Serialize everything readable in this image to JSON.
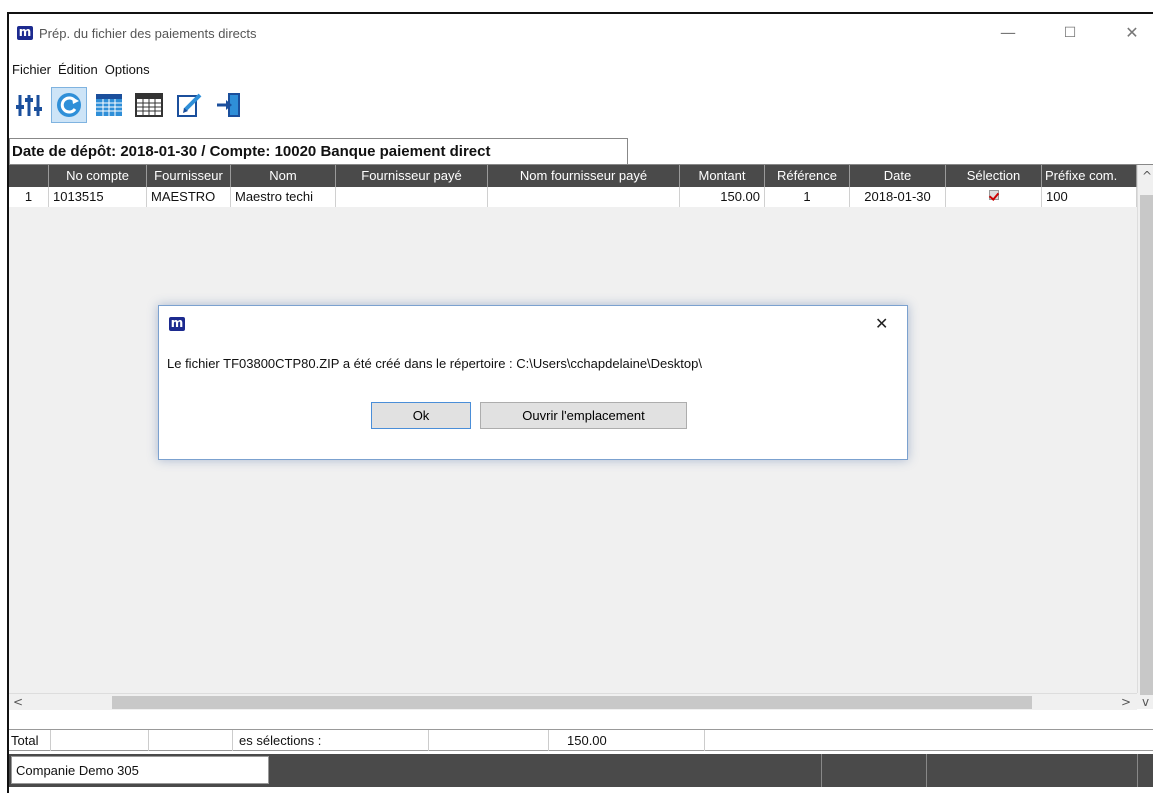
{
  "window": {
    "title": "Prép. du fichier des paiements directs",
    "logo_letter": "m",
    "controls": {
      "minimize": "—",
      "maximize": "☐",
      "close": "✕"
    }
  },
  "menu": [
    {
      "label": "Fichier"
    },
    {
      "label": "Édition"
    },
    {
      "label": "Options"
    }
  ],
  "toolbar": {
    "buttons": [
      {
        "icon": "sliders-icon"
      },
      {
        "icon": "refresh-icon",
        "active": true
      },
      {
        "icon": "grid-blue-icon"
      },
      {
        "icon": "grid-icon"
      },
      {
        "icon": "edit-icon"
      },
      {
        "icon": "exit-icon"
      }
    ]
  },
  "tab": {
    "label": "Date de dépôt: 2018-01-30 / Compte: 10020 Banque paiement direct"
  },
  "table": {
    "columns": [
      "",
      "No compte",
      "Fournisseur",
      "Nom",
      "Fournisseur payé",
      "Nom fournisseur payé",
      "Montant",
      "Référence",
      "Date",
      "Sélection",
      "Préfixe com."
    ],
    "rows": [
      [
        "1",
        "1013515",
        "MAESTRO",
        "Maestro techi",
        "",
        "",
        "150.00",
        "1",
        "2018-01-30",
        "checked",
        "100"
      ]
    ]
  },
  "scroll": {
    "up": "^",
    "down": "v",
    "left": "<",
    "right": ">"
  },
  "totals": {
    "label": "Total",
    "selection_label": "es sélections :",
    "amount": "150.00"
  },
  "status": {
    "company": "Companie Demo 305"
  },
  "dialog": {
    "logo_letter": "m",
    "close": "✕",
    "message": "Le fichier TF03800CTP80.ZIP a été créé dans le répertoire : C:\\Users\\cchapdelaine\\Desktop\\",
    "ok_label": "Ok",
    "open_label": "Ouvrir l'emplacement"
  },
  "colors": {
    "header_bg": "#4a4a4a",
    "logo_blue": "#1c2a8f",
    "active_btn": "#cde4f7",
    "check_red": "#c00000"
  }
}
